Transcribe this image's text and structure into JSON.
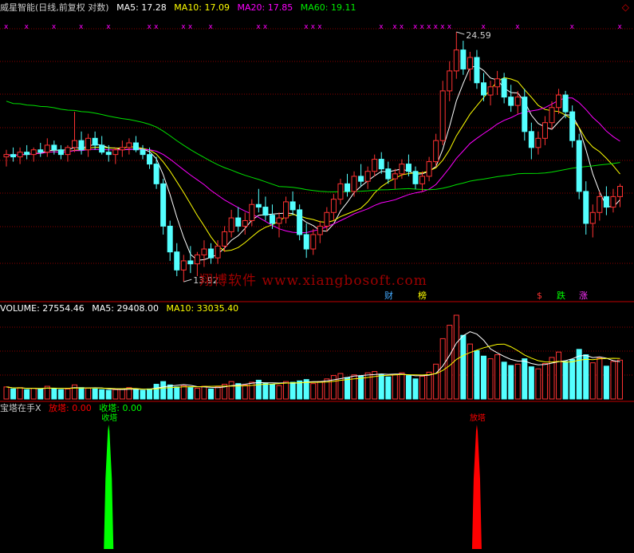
{
  "header": {
    "title": "威星智能(日线,前复权 对数)",
    "ma5": "MA5: 17.28",
    "ma10": "MA10: 17.09",
    "ma20": "MA20: 17.85",
    "ma60": "MA60: 19.11"
  },
  "volume_header": {
    "label": "VOLUME: 27554.46",
    "ma5": "MA5: 29408.00",
    "ma10": "MA10: 33035.40"
  },
  "indicator_header": {
    "name": "宝塔在手X",
    "fang": "放塔: 0.00",
    "shou": "收塔: 0.00"
  },
  "annotations": {
    "high": "24.59",
    "low": "13.92",
    "shou_label": "收塔",
    "fang_label": "放塔"
  },
  "event_tags": [
    "财",
    "榜",
    "$",
    "跌",
    "涨"
  ],
  "watermark": "翔博软件 www.xiangbosoft.com",
  "colors": {
    "up": "#ff3232",
    "down": "#54ffff",
    "ma5": "#ffffff",
    "ma10": "#ffff00",
    "ma20": "#ff00ff",
    "ma60": "#00e000",
    "grid": "#8b0000",
    "divider": "#c00000",
    "shou": "#00ff00",
    "fang": "#ff0000"
  },
  "chart_data": {
    "type": "candlestick",
    "candles": [
      [
        18.5,
        18.8,
        18.1,
        18.6
      ],
      [
        18.6,
        18.9,
        18.3,
        18.5
      ],
      [
        18.5,
        18.9,
        18.2,
        18.7
      ],
      [
        18.7,
        19.0,
        18.4,
        18.6
      ],
      [
        18.6,
        18.9,
        18.3,
        18.8
      ],
      [
        18.8,
        19.1,
        18.5,
        18.7
      ],
      [
        18.7,
        19.3,
        18.5,
        19.0
      ],
      [
        19.0,
        19.2,
        18.6,
        18.8
      ],
      [
        18.8,
        19.0,
        18.4,
        18.6
      ],
      [
        18.6,
        19.0,
        18.3,
        18.9
      ],
      [
        18.9,
        20.5,
        18.7,
        19.2
      ],
      [
        19.2,
        19.6,
        18.6,
        18.8
      ],
      [
        18.8,
        19.5,
        18.5,
        19.3
      ],
      [
        19.3,
        19.6,
        18.8,
        19.0
      ],
      [
        19.0,
        19.4,
        18.6,
        18.7
      ],
      [
        18.7,
        19.0,
        18.3,
        18.6
      ],
      [
        18.6,
        18.9,
        18.2,
        18.8
      ],
      [
        18.8,
        19.2,
        18.5,
        18.9
      ],
      [
        18.9,
        19.3,
        18.6,
        19.1
      ],
      [
        19.1,
        19.4,
        18.7,
        18.8
      ],
      [
        18.8,
        19.0,
        18.4,
        18.6
      ],
      [
        18.6,
        18.9,
        18.0,
        18.2
      ],
      [
        18.2,
        18.5,
        17.2,
        17.4
      ],
      [
        17.4,
        17.6,
        15.5,
        15.8
      ],
      [
        15.8,
        16.0,
        14.6,
        14.9
      ],
      [
        14.9,
        15.2,
        14.1,
        14.3
      ],
      [
        14.3,
        14.8,
        13.92,
        14.6
      ],
      [
        14.6,
        15.1,
        14.2,
        14.5
      ],
      [
        14.5,
        14.9,
        14.1,
        14.8
      ],
      [
        14.8,
        15.3,
        14.4,
        15.0
      ],
      [
        15.0,
        15.2,
        14.5,
        14.7
      ],
      [
        14.7,
        15.3,
        14.5,
        15.1
      ],
      [
        15.1,
        15.8,
        14.9,
        15.6
      ],
      [
        15.6,
        16.4,
        15.4,
        16.1
      ],
      [
        16.1,
        16.5,
        15.6,
        15.8
      ],
      [
        15.8,
        16.3,
        15.5,
        16.0
      ],
      [
        16.0,
        16.8,
        15.8,
        16.6
      ],
      [
        16.6,
        17.2,
        16.3,
        16.5
      ],
      [
        16.5,
        16.9,
        16.0,
        16.2
      ],
      [
        16.2,
        16.6,
        15.7,
        15.9
      ],
      [
        15.9,
        16.3,
        15.4,
        16.1
      ],
      [
        16.1,
        16.9,
        15.9,
        16.7
      ],
      [
        16.7,
        17.1,
        16.2,
        16.4
      ],
      [
        16.4,
        16.6,
        15.3,
        15.5
      ],
      [
        15.5,
        15.9,
        14.7,
        15.0
      ],
      [
        15.0,
        15.7,
        14.8,
        15.5
      ],
      [
        15.5,
        16.0,
        15.2,
        15.8
      ],
      [
        15.8,
        16.5,
        15.6,
        16.3
      ],
      [
        16.3,
        17.0,
        16.0,
        16.8
      ],
      [
        16.8,
        17.6,
        16.6,
        17.4
      ],
      [
        17.4,
        17.8,
        16.9,
        17.1
      ],
      [
        17.1,
        17.9,
        16.9,
        17.7
      ],
      [
        17.7,
        18.2,
        17.3,
        17.5
      ],
      [
        17.5,
        18.1,
        17.2,
        17.9
      ],
      [
        17.9,
        18.6,
        17.7,
        18.4
      ],
      [
        18.4,
        18.7,
        17.8,
        18.0
      ],
      [
        18.0,
        18.3,
        17.4,
        17.6
      ],
      [
        17.6,
        18.0,
        17.2,
        17.8
      ],
      [
        17.8,
        18.4,
        17.6,
        18.2
      ],
      [
        18.2,
        18.6,
        17.7,
        17.9
      ],
      [
        17.9,
        18.1,
        17.2,
        17.4
      ],
      [
        17.4,
        17.9,
        17.1,
        17.7
      ],
      [
        17.7,
        18.5,
        17.5,
        18.3
      ],
      [
        18.3,
        19.5,
        18.1,
        19.2
      ],
      [
        19.2,
        22.0,
        19.0,
        21.5
      ],
      [
        21.5,
        23.0,
        21.0,
        22.5
      ],
      [
        22.5,
        24.59,
        22.1,
        23.6
      ],
      [
        23.6,
        24.1,
        22.3,
        22.6
      ],
      [
        22.6,
        23.5,
        22.0,
        23.2
      ],
      [
        23.2,
        23.6,
        21.6,
        21.9
      ],
      [
        21.9,
        22.4,
        21.0,
        21.3
      ],
      [
        21.3,
        22.0,
        20.8,
        21.7
      ],
      [
        21.7,
        22.5,
        21.3,
        22.1
      ],
      [
        22.1,
        22.4,
        20.9,
        21.2
      ],
      [
        21.2,
        21.8,
        20.5,
        20.8
      ],
      [
        20.8,
        21.5,
        20.4,
        21.2
      ],
      [
        21.2,
        21.6,
        19.2,
        19.6
      ],
      [
        19.6,
        20.0,
        18.4,
        18.9
      ],
      [
        18.9,
        19.6,
        18.6,
        19.3
      ],
      [
        19.3,
        20.3,
        19.0,
        20.0
      ],
      [
        20.0,
        21.0,
        19.7,
        20.7
      ],
      [
        20.7,
        21.6,
        20.4,
        21.3
      ],
      [
        21.3,
        21.5,
        20.2,
        20.5
      ],
      [
        20.5,
        20.8,
        18.9,
        19.2
      ],
      [
        19.2,
        19.5,
        16.8,
        17.1
      ],
      [
        17.1,
        17.5,
        15.5,
        15.9
      ],
      [
        15.9,
        16.6,
        15.4,
        16.3
      ],
      [
        16.3,
        17.1,
        16.0,
        16.9
      ],
      [
        16.9,
        17.3,
        16.2,
        16.5
      ],
      [
        16.5,
        17.2,
        16.3,
        16.9
      ],
      [
        16.9,
        17.4,
        16.5,
        17.3
      ]
    ],
    "volume": [
      1800,
      1500,
      1700,
      1400,
      1600,
      1500,
      1900,
      1600,
      1400,
      1500,
      2100,
      1700,
      1600,
      1500,
      1400,
      1300,
      1400,
      1500,
      1700,
      1400,
      1300,
      1500,
      2200,
      2600,
      2100,
      1800,
      2000,
      1700,
      1600,
      1900,
      1500,
      1800,
      2200,
      2600,
      2300,
      2100,
      2500,
      2800,
      2400,
      2200,
      2000,
      2600,
      2500,
      2700,
      2900,
      2300,
      2600,
      3000,
      3500,
      3800,
      3200,
      3600,
      3400,
      3900,
      4100,
      3700,
      3300,
      3600,
      3900,
      3500,
      3000,
      3400,
      4000,
      5200,
      9000,
      11000,
      12500,
      9500,
      8200,
      7200,
      6400,
      6000,
      6600,
      5500,
      5000,
      5200,
      6000,
      4800,
      4500,
      5300,
      6200,
      7000,
      5600,
      5900,
      7400,
      6600,
      5400,
      6100,
      4900,
      5600,
      5800
    ],
    "volume_ma5": "29408.00",
    "volume_ma10": "33035.40",
    "indicator_spikes": [
      {
        "label": "收塔",
        "index": 15,
        "color": "shou"
      },
      {
        "label": "放塔",
        "index": 69,
        "color": "fang"
      }
    ],
    "price_range": [
      13.5,
      25.5
    ]
  }
}
